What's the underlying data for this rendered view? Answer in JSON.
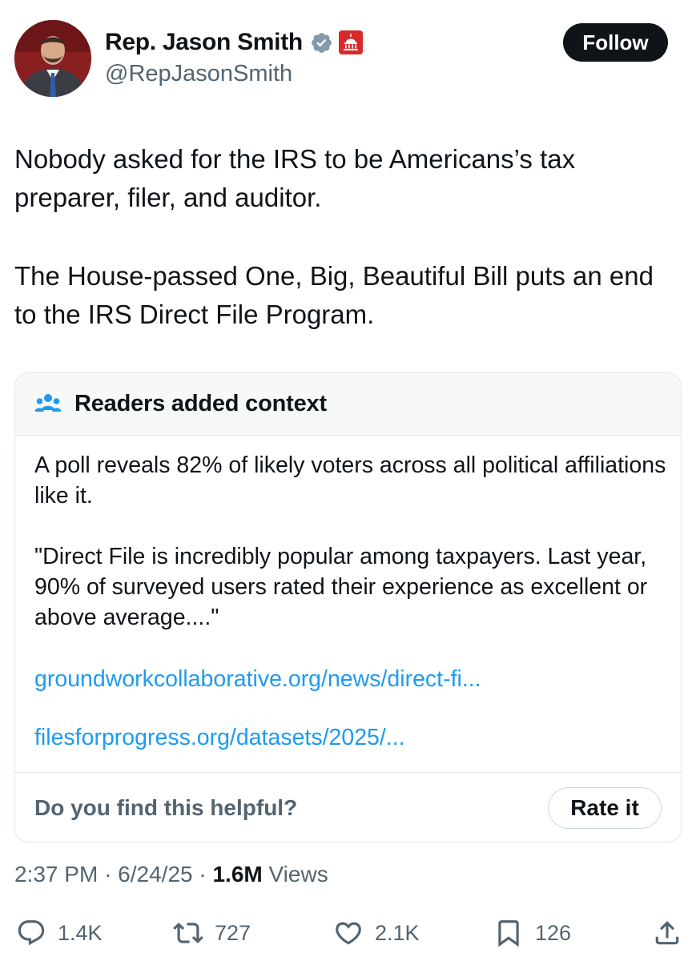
{
  "author": {
    "display_name": "Rep. Jason Smith",
    "handle": "@RepJasonSmith",
    "verified_icon": "verified-badge-icon",
    "affiliation_icon": "capitol-dome-icon",
    "avatar": "profile-photo"
  },
  "follow_label": "Follow",
  "tweet": {
    "paragraphs": [
      "Nobody asked for the IRS to be Americans’s tax preparer, filer, and auditor.",
      "The House-passed One, Big, Beautiful Bill puts an end to the IRS Direct File Program."
    ]
  },
  "community_note": {
    "icon": "people-icon",
    "title": "Readers added context",
    "body": [
      "A poll reveals 82% of likely voters across all political affiliations like it.",
      "\"Direct File is incredibly popular among taxpayers. Last year, 90% of surveyed users rated their experience as excellent or above average....\""
    ],
    "links": [
      "groundworkcollaborative.org/news/direct-fi...",
      "filesforprogress.org/datasets/2025/..."
    ],
    "helpful_question": "Do you find this helpful?",
    "rate_label": "Rate it"
  },
  "meta": {
    "time": "2:37 PM",
    "separator": "·",
    "date": "6/24/25",
    "views_count": "1.6M",
    "views_label": "Views"
  },
  "actions": {
    "replies": "1.4K",
    "reposts": "727",
    "likes": "2.1K",
    "bookmarks": "126"
  },
  "colors": {
    "text": "#0f1419",
    "secondary": "#536471",
    "link": "#1d9bf0",
    "border": "#e1e8ed",
    "verified": "#829aab",
    "affiliation": "#d52b2b"
  }
}
